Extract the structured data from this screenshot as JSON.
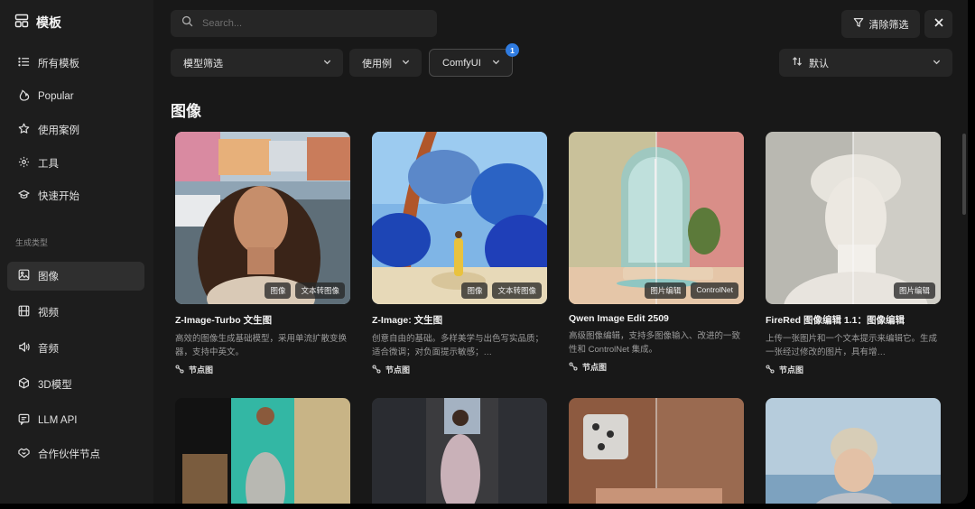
{
  "app": {
    "title": "模板"
  },
  "sidebar": {
    "items": [
      {
        "label": "所有模板",
        "icon": "list-icon"
      },
      {
        "label": "Popular",
        "icon": "flame-icon"
      },
      {
        "label": "使用案例",
        "icon": "star-icon"
      },
      {
        "label": "工具",
        "icon": "gear-icon"
      },
      {
        "label": "快速开始",
        "icon": "graduation-cap-icon"
      }
    ],
    "section_label": "生成类型",
    "gen_items": [
      {
        "label": "图像",
        "icon": "image-icon",
        "active": true
      },
      {
        "label": "视频",
        "icon": "film-icon"
      },
      {
        "label": "音频",
        "icon": "speaker-icon"
      },
      {
        "label": "3D模型",
        "icon": "cube-icon"
      },
      {
        "label": "LLM API",
        "icon": "chat-icon"
      },
      {
        "label": "合作伙伴节点",
        "icon": "handshake-icon"
      }
    ]
  },
  "toolbar": {
    "search_placeholder": "Search...",
    "clear_filters_label": "清除筛选",
    "model_filter_label": "模型筛选",
    "use_case_label": "使用例",
    "comfyui_label": "ComfyUI",
    "comfyui_badge": "1",
    "sort_label": "默认"
  },
  "section": {
    "title": "图像"
  },
  "cards": [
    {
      "title": "Z-Image-Turbo 文生图",
      "desc": "高效的图像生成基础模型，采用单流扩散变换器，支持中英文。",
      "tags": [
        "图像",
        "文本转图像"
      ],
      "meta": "节点图"
    },
    {
      "title": "Z-Image: 文生图",
      "desc": "创意自由的基础。多样美学与出色写实品质；适合微调；对负面提示敏感；…",
      "tags": [
        "图像",
        "文本转图像"
      ],
      "meta": "节点图"
    },
    {
      "title": "Qwen Image Edit 2509",
      "desc": "高级图像编辑，支持多图像输入、改进的一致性和 ControlNet 集成。",
      "tags": [
        "图片编辑",
        "ControlNet"
      ],
      "meta": "节点图"
    },
    {
      "title": "FireRed 图像编辑 1.1：图像编辑",
      "desc": "上传一张图片和一个文本提示来编辑它。生成一张经过修改的图片，具有增…",
      "tags": [
        "图片编辑"
      ],
      "meta": "节点图"
    }
  ],
  "colors": {
    "bg": "#181818",
    "sidebar_bg": "#1d1d1d",
    "accent_badge": "#2f7be0"
  }
}
